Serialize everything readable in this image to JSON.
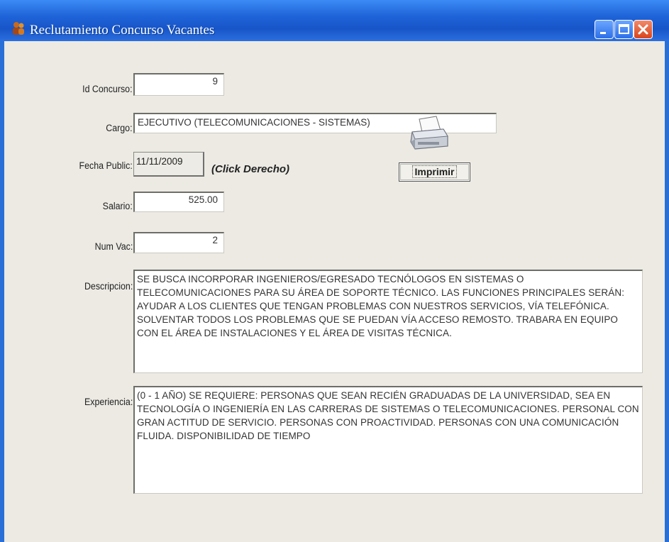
{
  "window": {
    "title": "Reclutamiento Concurso Vacantes",
    "controls": {
      "minimize": "minimize-icon",
      "maximize": "maximize-icon",
      "close": "close-icon"
    }
  },
  "form": {
    "id_concurso": {
      "label": "Id Concurso:",
      "value": "9"
    },
    "cargo": {
      "label": "Cargo:",
      "value": "EJECUTIVO (TELECOMUNICACIONES - SISTEMAS)"
    },
    "fecha_public": {
      "label": "Fecha Public:",
      "value": "11/11/2009",
      "hint": "(Click Derecho)"
    },
    "salario": {
      "label": "Salario:",
      "value": "525.00"
    },
    "num_vac": {
      "label": "Num Vac:",
      "value": "2"
    },
    "descripcion": {
      "label": "Descripcion:",
      "value": "SE BUSCA INCORPORAR INGENIEROS/EGRESADO TECNÓLOGOS EN SISTEMAS O TELECOMUNICACIONES PARA SU ÁREA DE SOPORTE TÉCNICO. LAS FUNCIONES PRINCIPALES SERÁN: AYUDAR A LOS CLIENTES QUE TENGAN PROBLEMAS CON NUESTROS SERVICIOS, VÍA TELEFÓNICA. SOLVENTAR TODOS LOS PROBLEMAS QUE SE PUEDAN VÍA ACCESO REMOSTO. TRABARA EN EQUIPO CON EL ÁREA DE INSTALACIONES Y EL ÁREA DE VISITAS TÉCNICA."
    },
    "experiencia": {
      "label": "Experiencia:",
      "value": "(0 - 1 AÑO)      SE REQUIERE: PERSONAS QUE SEAN RECIÉN GRADUADAS DE LA UNIVERSIDAD, SEA EN TECNOLOGÍA O INGENIERÍA EN LAS CARRERAS DE SISTEMAS O TELECOMUNICACIONES. PERSONAL CON GRAN ACTITUD DE SERVICIO. PERSONAS CON PROACTIVIDAD. PERSONAS CON UNA COMUNICACIÓN FLUIDA. DISPONIBILIDAD DE TIEMPO"
    }
  },
  "actions": {
    "print_label": "Imprimir",
    "print_icon": "printer-icon"
  },
  "colors": {
    "title_bar": "#1f63d8",
    "client_bg": "#eceae3",
    "close_button": "#d9441c"
  }
}
